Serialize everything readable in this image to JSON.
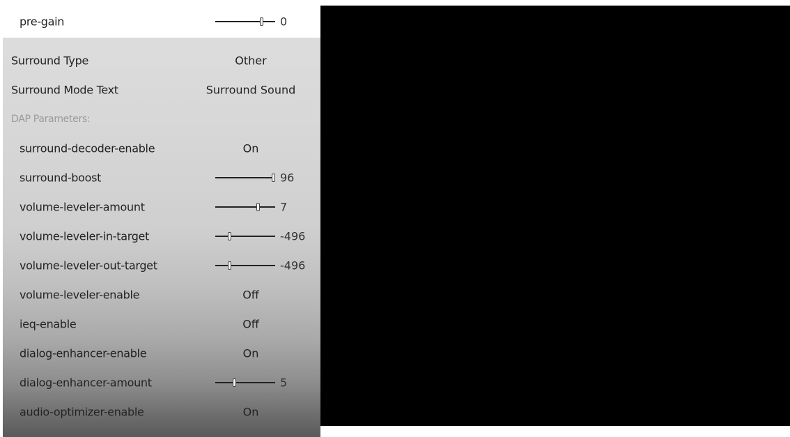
{
  "settings": {
    "pre_gain": {
      "label": "pre-gain",
      "value": "0",
      "level": 0.78
    },
    "surround_type": {
      "label": "Surround Type",
      "value": "Other"
    },
    "surround_mode_text": {
      "label": "Surround Mode Text",
      "value": "Surround Sound"
    },
    "dap_header": {
      "label": "DAP Parameters:"
    },
    "surround_decoder_enable": {
      "label": "surround-decoder-enable",
      "value": "On"
    },
    "surround_boost": {
      "label": "surround-boost",
      "value": "96",
      "level": 0.98
    },
    "volume_leveler_amount": {
      "label": "volume-leveler-amount",
      "value": "7",
      "level": 0.72
    },
    "volume_leveler_in_target": {
      "label": "volume-leveler-in-target",
      "value": "-496",
      "level": 0.24
    },
    "volume_leveler_out_target": {
      "label": "volume-leveler-out-target",
      "value": "-496",
      "level": 0.24
    },
    "volume_leveler_enable": {
      "label": "volume-leveler-enable",
      "value": "Off"
    },
    "ieq_enable": {
      "label": "ieq-enable",
      "value": "Off"
    },
    "dialog_enhancer_enable": {
      "label": "dialog-enhancer-enable",
      "value": "On"
    },
    "dialog_enhancer_amount": {
      "label": "dialog-enhancer-amount",
      "value": "5",
      "level": 0.33
    },
    "audio_optimizer_enable": {
      "label": "audio-optimizer-enable",
      "value": "On"
    }
  }
}
